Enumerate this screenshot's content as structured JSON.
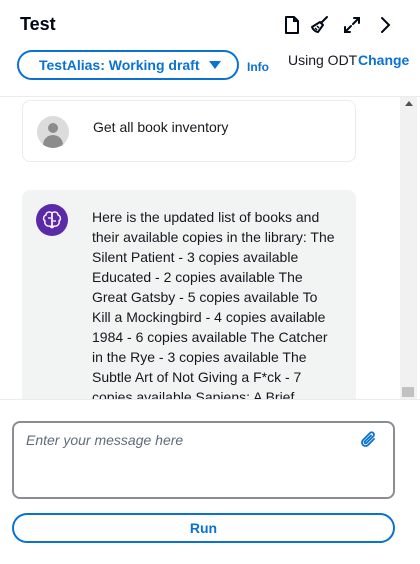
{
  "header": {
    "title": "Test",
    "icons": [
      "document-icon",
      "broom-icon",
      "expand-icon",
      "chevron-right-icon"
    ]
  },
  "alias": {
    "selected": "TestAlias: Working draft",
    "info_link": "Info"
  },
  "odt": {
    "label": "Using ODT",
    "change_link": "Change"
  },
  "messages": [
    {
      "role": "user",
      "text": "Get all book inventory"
    },
    {
      "role": "agent",
      "text": "Here is the updated list of books and their available copies in the library: The Silent Patient - 3 copies available Educated - 2 copies available The Great Gatsby - 5 copies available To Kill a Mockingbird - 4 copies available 1984 - 6 copies available The Catcher in the Rye - 3 copies available The Subtle Art of Not Giving a F*ck - 7 copies available Sapiens: A Brief"
    }
  ],
  "composer": {
    "placeholder": "Enter your message here",
    "value": "",
    "run_label": "Run"
  },
  "colors": {
    "accent": "#0972d3",
    "agent_avatar": "#5b2aa8",
    "agent_bubble": "#f2f3f3"
  }
}
